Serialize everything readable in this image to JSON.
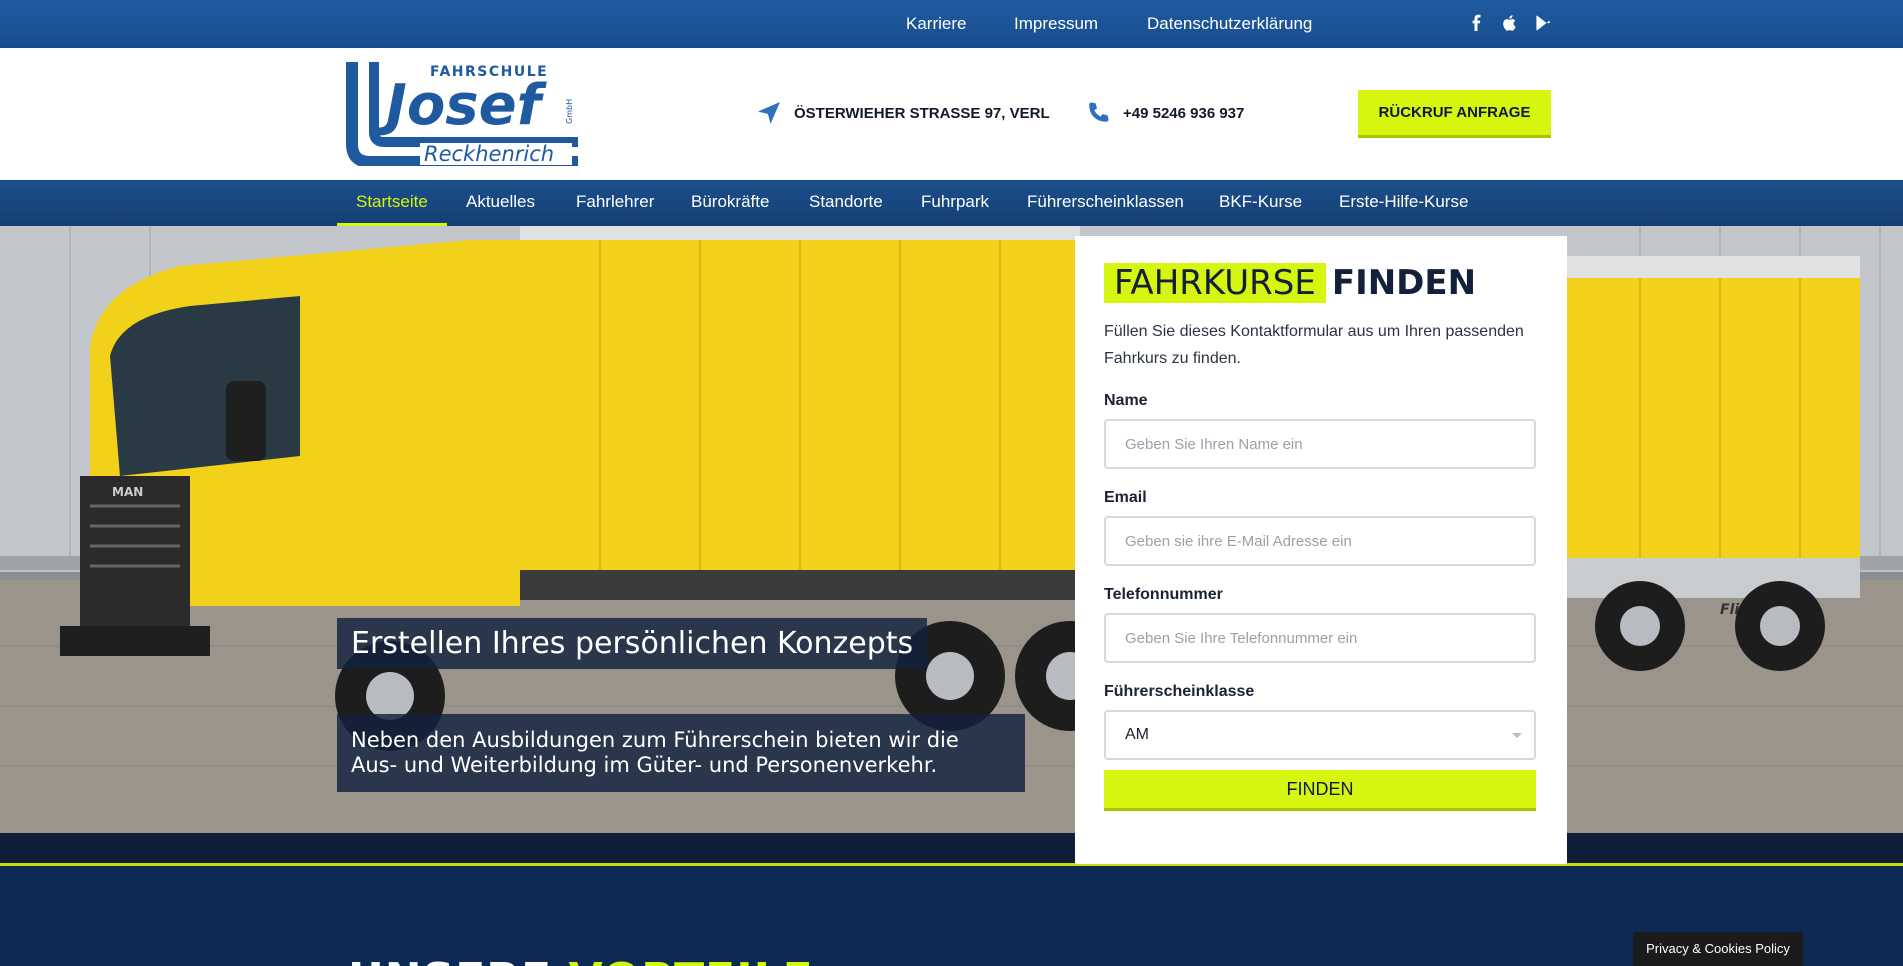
{
  "topbar": {
    "links": [
      "Karriere",
      "Impressum",
      "Datenschutzerklärung"
    ],
    "social_icons": [
      "facebook-icon",
      "apple-icon",
      "google-play-icon"
    ]
  },
  "header": {
    "logo": {
      "top": "FAHRSCHULE",
      "name": "Josef",
      "suffix": "GmbH",
      "bottom": "Reckhenrich"
    },
    "address": "ÖSTERWIEHER STRASSE 97, VERL",
    "phone": "+49 5246 936 937",
    "callback_label": "RÜCKRUF ANFRAGE"
  },
  "nav": {
    "items": [
      "Startseite",
      "Aktuelles",
      "Fahrlehrer",
      "Bürokräfte",
      "Standorte",
      "Fuhrpark",
      "Führerscheinklassen",
      "BKF-Kurse",
      "Erste-Hilfe-Kurse"
    ],
    "active_index": 0
  },
  "hero": {
    "title": "Erstellen Ihres persönlichen Konzepts",
    "text": "Neben den Ausbildungen zum Führerschein bieten wir die Aus- und Weiterbildung im Güter- und Personenverkehr.",
    "truck": {
      "plate_brand": "MAN",
      "trailer_brand": "Fliegl"
    }
  },
  "form": {
    "title_highlight": "FAHRKURSE",
    "title_rest": "FINDEN",
    "intro": "Füllen Sie dieses Kontaktformular aus um Ihren passenden Fahrkurs zu finden.",
    "name_label": "Name",
    "name_placeholder": "Geben Sie Ihren Name ein",
    "email_label": "Email",
    "email_placeholder": "Geben sie ihre E-Mail Adresse ein",
    "phone_label": "Telefonnummer",
    "phone_placeholder": "Geben Sie Ihre Telefonnummer ein",
    "class_label": "Führerscheinklasse",
    "class_value": "AM",
    "submit_label": "FINDEN"
  },
  "section": {
    "heading_start": "UNSERE",
    "heading_highlight": "VORTEILE"
  },
  "privacy_badge": "Privacy & Cookies Policy",
  "colors": {
    "brand_blue": "#1f5aa0",
    "nav_blue": "#174680",
    "accent_lime": "#d6f50f",
    "dark_navy": "#0d2a55",
    "truck_yellow": "#f2d11b"
  }
}
